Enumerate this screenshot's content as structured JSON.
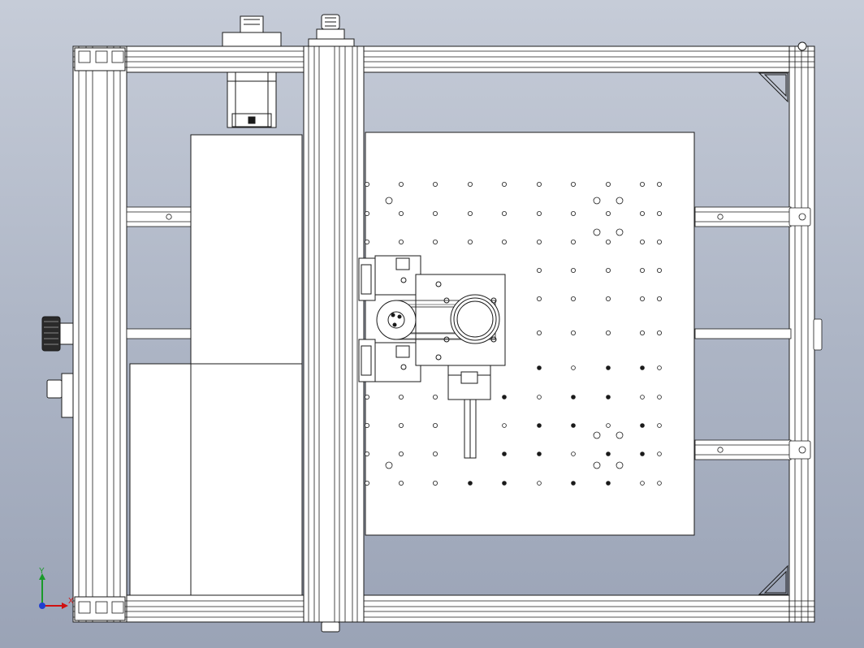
{
  "view": {
    "background_top": "#c6ccd8",
    "background_bottom": "#9aa3b6",
    "line_color": "#1a1a1a",
    "plate_color": "#ffffff"
  },
  "triad": {
    "x_label": "X",
    "y_label": "Y",
    "x_color": "#d01010",
    "y_color": "#1a9a2a",
    "z_color": "#1f3fd0"
  }
}
